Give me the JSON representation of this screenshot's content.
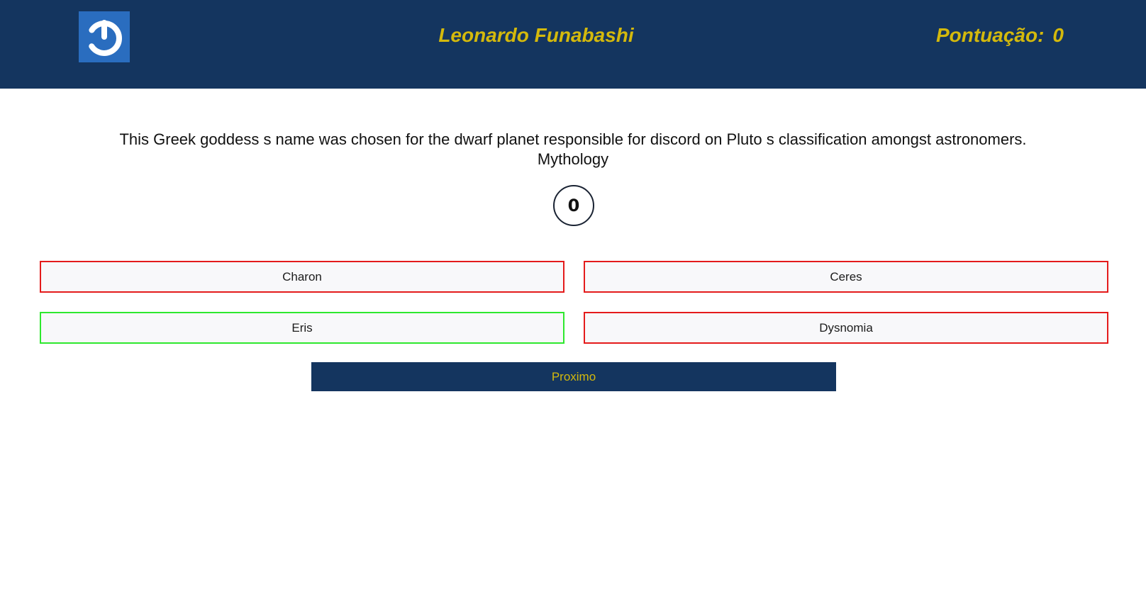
{
  "header": {
    "player_name": "Leonardo Funabashi",
    "score_label": "Pontuação:",
    "score_value": "0",
    "logo_icon": "power-icon",
    "colors": {
      "background": "#14355f",
      "accent": "#d4b90c",
      "logo_bg": "#2a6dbf"
    }
  },
  "quiz": {
    "question": "This Greek goddess s name was chosen for the dwarf planet responsible for discord on Pluto s classification amongst astronomers.",
    "category": "Mythology",
    "timer": "0",
    "answers": [
      {
        "label": "Charon",
        "status": "incorrect"
      },
      {
        "label": "Ceres",
        "status": "incorrect"
      },
      {
        "label": "Eris",
        "status": "correct"
      },
      {
        "label": "Dysnomia",
        "status": "incorrect"
      }
    ],
    "status_colors": {
      "correct": "#2ee82e",
      "incorrect": "#e41b1b"
    },
    "next_label": "Proximo"
  }
}
